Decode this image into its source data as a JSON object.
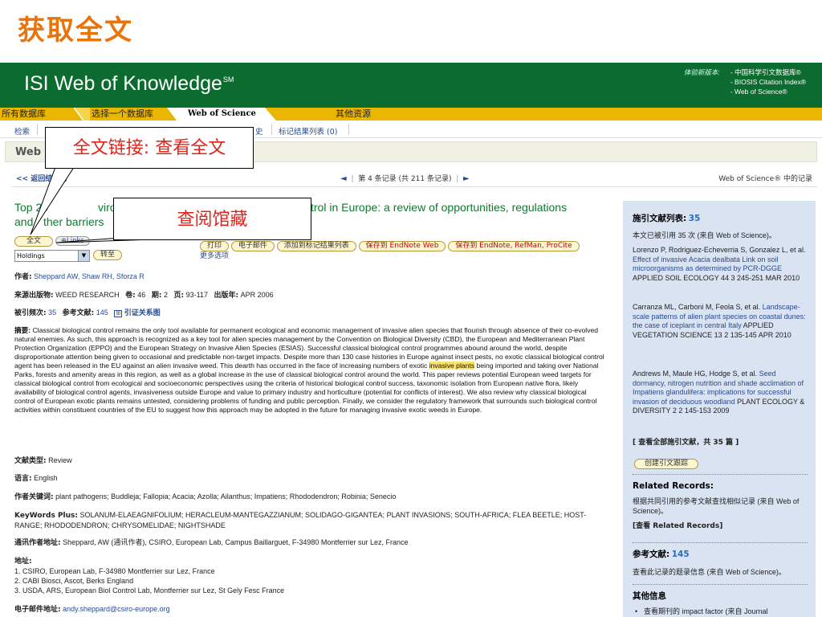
{
  "slide": {
    "title": "获取全文"
  },
  "header": {
    "logo": "ISI Web of Knowledge",
    "logo_mark": "SM",
    "trial_label": "体验新版本:",
    "trial_links": [
      "- 中国科学引文数据库®",
      "- BIOSIS Citation Index®",
      "- Web of Science®"
    ]
  },
  "tabs": {
    "all": "所有数据库",
    "one": "选择一个数据库",
    "wos": "Web of Science",
    "other": "其他资源"
  },
  "subnav": {
    "search": "检索",
    "history": "史",
    "marked": "标记结果列表 (0)"
  },
  "wosbar": {
    "title": "Web of Science"
  },
  "nav": {
    "back": "<< 返回结果列",
    "prev": "◄",
    "record_info": "第 4 条记录 (共 211 条记录)",
    "next": "►",
    "wos_records": "Web of Science® 中的记录"
  },
  "callouts": {
    "fulltext": "全文链接: 查看全文",
    "holdings": "查阅馆藏"
  },
  "record": {
    "title_a": "Top 20",
    "title_b": "vironme",
    "title_c": "trol in Europe: a review of opportunities, regulations",
    "title_d": "and",
    "title_e": "ther barriers",
    "buttons": {
      "fulltext": "全文",
      "links": "Links",
      "print": "打印",
      "email": "电子邮件",
      "add_marked": "添加到标记结果列表",
      "save_endnote_web": "保存到 EndNote Web",
      "save_endnote_etc": "保存到 EndNote, RefMan, ProCite",
      "more_options": "更多选项",
      "holdings_value": "Holdings",
      "goto": "转至"
    },
    "authors_label": "作者:",
    "authors": "Sheppard AW, Shaw RH, Sforza R",
    "source_label": "来源出版物:",
    "source": "WEED RESEARCH",
    "volume_label": "卷:",
    "volume": "46",
    "issue_label": "期:",
    "issue": "2",
    "pages_label": "页:",
    "pages": "93-117",
    "year_label": "出版年:",
    "year": "APR 2006",
    "cited_label": "被引频次:",
    "cited": "35",
    "refs_label": "参考文献:",
    "refs": "145",
    "citation_map": "引证关系图",
    "abstract_label": "摘要:",
    "abstract_a": "Classical biological control remains the only tool available for permanent ecological and economic management of invasive alien species that flourish through absence of their co-evolved natural enemies. As such, this approach is recognized as a key tool for alien species management by the Convention on Biological Diversity (CBD), the European and Mediterranean Plant Protection Organization (EPPO) and the European Strategy on Invasive Alien Species (ESIAS). Successful classical biological control programmes abound around the world, despite disproportionate attention being given to occasional and predictable non-target impacts. Despite more than 130 case histories in Europe against insect pests, no exotic classical biological control agent has been released in the EU against an alien invasive weed. This dearth has occurred in the face of increasing numbers of exotic ",
    "abstract_hl": "invasive plants",
    "abstract_b": " being imported and taking over National Parks, forests and amenity areas in this region, as well as a global increase in the use of classical biological control around the world. This paper reviews potential European weed targets for classical biological control from ecological and socioeconomic perspectives using the criteria of historical biological control success, taxonomic isolation from European native flora, likely availability of biological control agents, invasiveness outside Europe and value to primary industry and horticulture (potential for conflicts of interest). We also review why classical biological control of European exotic plants remains untested, considering problems of funding and public perception. Finally, we consider the regulatory framework that surrounds such biological control activities within constituent countries of the EU to suggest how this approach may be adopted in the future for managing invasive exotic weeds in Europe.",
    "doctype_label": "文献类型:",
    "doctype": "Review",
    "lang_label": "语言:",
    "lang": "English",
    "keywords_label": "作者关键词:",
    "keywords": "plant pathogens; Buddleja; Fallopia; Acacia; Azolla; Ailanthus; Impatiens; Rhododendron; Robinia; Senecio",
    "kwplus_label": "KeyWords Plus:",
    "kwplus": "SOLANUM-ELAEAGNIFOLIUM; HERACLEUM-MANTEGAZZIANUM; SOLIDAGO-GIGANTEA; PLANT INVASIONS; SOUTH-AFRICA; FLEA BEETLE; HOST-RANGE; RHODODENDRON; CHRYSOMELIDAE; NIGHTSHADE",
    "corr_label": "通讯作者地址:",
    "corr": "Sheppard, AW (通讯作者), CSIRO, European Lab, Campus Baillarguet, F-34980 Montferrier sur Lez, France",
    "addr_label": "地址:",
    "addresses": [
      "1. CSIRO, European Lab, F-34980 Montferrier sur Lez, France",
      "2. CABI Biosci, Ascot, Berks England",
      "3. USDA, ARS, European Biol Control Lab, Montferrier sur Lez, St Gely Fesc France"
    ],
    "email_label": "电子邮件地址:",
    "email": "andy.sheppard@csiro-europe.org"
  },
  "sidebar": {
    "citing_label": "施引文献列表:",
    "citing_count": "35",
    "citing_note": "本文已被引用 35 次 (来自 Web of Science)。",
    "items": [
      {
        "authors": "Lorenzo P, Rodriguez-Echeverria S, Gonzalez L, et al.",
        "title": "Effect of invasive Acacia dealbata Link on soil microorganisms as determined by PCR-DGGE",
        "source": "APPLIED SOIL ECOLOGY 44 3 245-251 MAR 2010"
      },
      {
        "authors": "Carranza ML, Carboni M, Feola S, et al.",
        "title": "Landscape-scale patterns of alien plant species on coastal dunes: the case of iceplant in central Italy",
        "source": "APPLIED VEGETATION SCIENCE 13 2 135-145 APR 2010"
      },
      {
        "authors": "Andrews M, Maule HG, Hodge S, et al.",
        "title": "Seed dormancy, nitrogen nutrition and shade acclimation of Impatiens glandulifera: implications for successful invasion of deciduous woodland",
        "source": "PLANT ECOLOGY & DIVERSITY 2 2 145-153 2009"
      }
    ],
    "view_all": "[ 查看全部施引文献，共 35 篇 ]",
    "create_alert": "创建引文跟踪",
    "related_title": "Related Records:",
    "related_note": "根据共同引用的参考文献查找相似记录 (来自 Web of Science)。",
    "related_link": "[查看 Related Records]",
    "refs_title": "参考文献:",
    "refs_count": "145",
    "refs_note": "查看此记录的题录信息 (来自 Web of Science)。",
    "other_title": "其他信息",
    "other_item": "查看期刊的 impact factor (来自 Journal"
  }
}
